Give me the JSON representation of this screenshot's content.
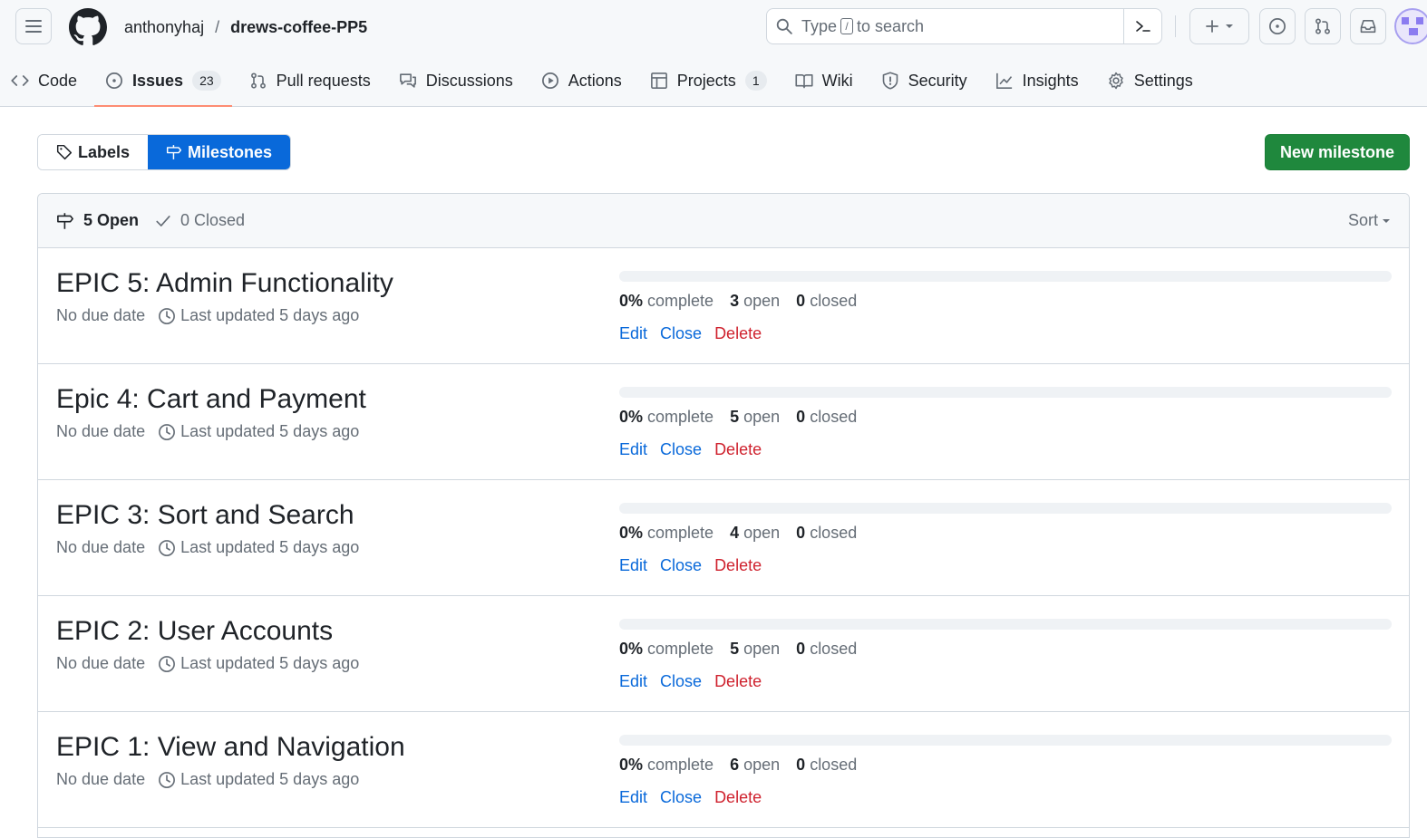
{
  "header": {
    "owner": "anthonyhaj",
    "separator": "/",
    "repo": "drews-coffee-PP5",
    "search": {
      "prefix": "Type",
      "key": "/",
      "suffix": "to search"
    },
    "icons": [
      "hamburger-icon",
      "github-logo-icon",
      "search-icon",
      "command-palette-icon",
      "plus-icon",
      "chevron-down-icon",
      "issue-opened-icon",
      "git-pull-request-icon",
      "inbox-icon",
      "avatar"
    ]
  },
  "tabs": [
    {
      "label": "Code",
      "icon": "code-icon"
    },
    {
      "label": "Issues",
      "icon": "issue-opened-icon",
      "count": "23",
      "active": true
    },
    {
      "label": "Pull requests",
      "icon": "git-pull-request-icon"
    },
    {
      "label": "Discussions",
      "icon": "comment-discussion-icon"
    },
    {
      "label": "Actions",
      "icon": "play-icon"
    },
    {
      "label": "Projects",
      "icon": "table-icon",
      "count": "1"
    },
    {
      "label": "Wiki",
      "icon": "book-icon"
    },
    {
      "label": "Security",
      "icon": "shield-icon"
    },
    {
      "label": "Insights",
      "icon": "graph-icon"
    },
    {
      "label": "Settings",
      "icon": "gear-icon"
    }
  ],
  "subnav": {
    "labels": "Labels",
    "milestones": "Milestones"
  },
  "new_milestone": "New milestone",
  "filter": {
    "open": "5 Open",
    "closed": "0 Closed",
    "sort": "Sort"
  },
  "milestones": [
    {
      "title": "EPIC 5: Admin Functionality",
      "due": "No due date",
      "updated": "Last updated 5 days ago",
      "percent": 0,
      "percent_label": "0%",
      "complete": "complete",
      "open": "3",
      "open_label": "open",
      "closed": "0",
      "closed_label": "closed",
      "edit": "Edit",
      "close": "Close",
      "delete": "Delete"
    },
    {
      "title": "Epic 4: Cart and Payment",
      "due": "No due date",
      "updated": "Last updated 5 days ago",
      "percent": 0,
      "percent_label": "0%",
      "complete": "complete",
      "open": "5",
      "open_label": "open",
      "closed": "0",
      "closed_label": "closed",
      "edit": "Edit",
      "close": "Close",
      "delete": "Delete"
    },
    {
      "title": "EPIC 3: Sort and Search",
      "due": "No due date",
      "updated": "Last updated 5 days ago",
      "percent": 0,
      "percent_label": "0%",
      "complete": "complete",
      "open": "4",
      "open_label": "open",
      "closed": "0",
      "closed_label": "closed",
      "edit": "Edit",
      "close": "Close",
      "delete": "Delete"
    },
    {
      "title": "EPIC 2: User Accounts",
      "due": "No due date",
      "updated": "Last updated 5 days ago",
      "percent": 0,
      "percent_label": "0%",
      "complete": "complete",
      "open": "5",
      "open_label": "open",
      "closed": "0",
      "closed_label": "closed",
      "edit": "Edit",
      "close": "Close",
      "delete": "Delete"
    },
    {
      "title": "EPIC 1: View and Navigation",
      "due": "No due date",
      "updated": "Last updated 5 days ago",
      "percent": 0,
      "percent_label": "0%",
      "complete": "complete",
      "open": "6",
      "open_label": "open",
      "closed": "0",
      "closed_label": "closed",
      "edit": "Edit",
      "close": "Close",
      "delete": "Delete"
    }
  ],
  "colors": {
    "accent": "#0969da",
    "primary_button": "#1f883d",
    "danger": "#cf222e",
    "active_tab_underline": "#fd8c73"
  }
}
